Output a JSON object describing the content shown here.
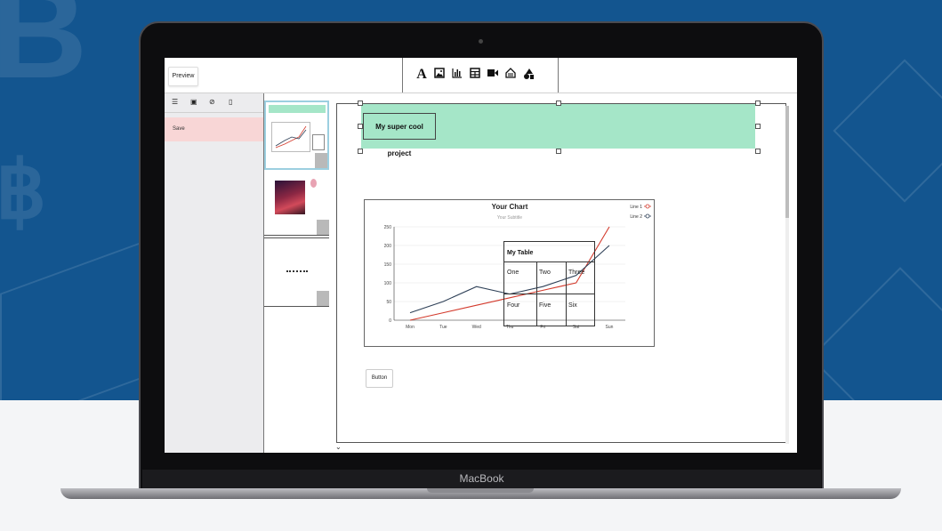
{
  "device": {
    "brand": "MacBook"
  },
  "topbar": {
    "preview_label": "Preview",
    "tools": [
      "text-tool",
      "image-tool",
      "chart-tool",
      "table-tool",
      "video-tool",
      "embed-tool",
      "shapes-tool"
    ]
  },
  "left_panel": {
    "tools": [
      "align-icon",
      "image-icon",
      "no-fill-icon",
      "page-icon"
    ],
    "items": [
      {
        "label": "Save"
      }
    ]
  },
  "slide": {
    "title": "My super cool project",
    "button_label": "Button",
    "header_color": "#a5e6c8"
  },
  "chart_data": {
    "type": "line",
    "title": "Your Chart",
    "subtitle": "Your Subtitle",
    "categories": [
      "Mon",
      "Tue",
      "Wed",
      "Thu",
      "Fri",
      "Sat",
      "Sun"
    ],
    "ylim": [
      0,
      250
    ],
    "yticks": [
      0,
      50,
      100,
      150,
      200,
      250
    ],
    "grid": true,
    "legend": "top-right",
    "series": [
      {
        "name": "Line 1",
        "color": "#d33a2c",
        "values": [
          0,
          20,
          40,
          60,
          80,
          100,
          250
        ]
      },
      {
        "name": "Line 2",
        "color": "#2e4057",
        "values": [
          20,
          50,
          90,
          70,
          90,
          120,
          200
        ]
      }
    ]
  },
  "table": {
    "title": "My Table",
    "rows": [
      [
        "One",
        "Two",
        "Three"
      ],
      [
        "Four",
        "Five",
        "Six"
      ]
    ]
  },
  "colors": {
    "accent_header": "#a5e6c8",
    "save_highlight": "#f8d6d6"
  }
}
